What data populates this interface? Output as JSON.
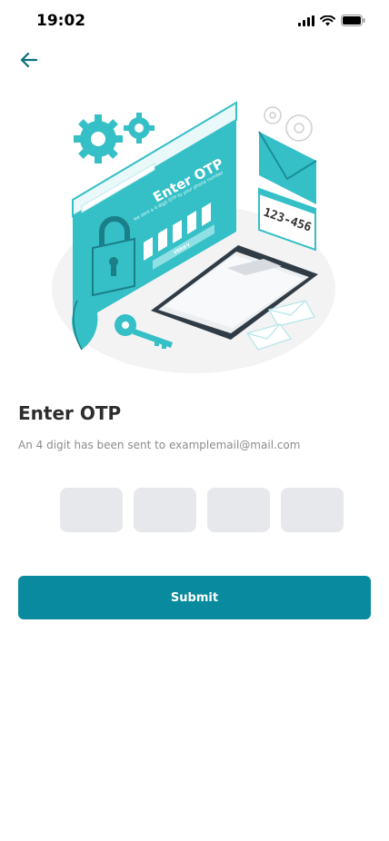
{
  "status_bar": {
    "time": "19:02"
  },
  "illustration": {
    "screen_title": "Enter OTP",
    "screen_subtext": "we sent a 4 digit OTP to your phone number",
    "verify_label": "VERIFY",
    "bubble_code": "123-456"
  },
  "page": {
    "title": "Enter OTP",
    "subtitle": "An 4 digit has been sent to examplemail@mail.com"
  },
  "otp": {
    "values": [
      "",
      "",
      "",
      ""
    ]
  },
  "actions": {
    "submit_label": "Submit"
  },
  "colors": {
    "accent": "#0a8a9e",
    "illustration_teal": "#35bfc6",
    "input_bg": "#e7e8ec"
  }
}
